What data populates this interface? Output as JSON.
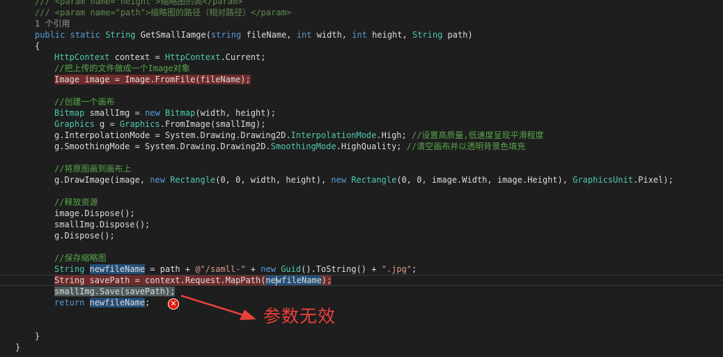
{
  "editor": {
    "lines": [
      {
        "tokens": [
          {
            "t": "/// <param name=\"height\">缩略图的高</param>",
            "c": "xml"
          }
        ]
      },
      {
        "tokens": [
          {
            "t": "/// <param name=\"path\">缩略图的路径（相对路径）</param>",
            "c": "xml"
          }
        ]
      },
      {
        "tokens": [
          {
            "t": "1 个引用",
            "c": "codelens"
          }
        ]
      },
      {
        "tokens": [
          {
            "t": "public",
            "c": "kw"
          },
          {
            "t": " "
          },
          {
            "t": "static",
            "c": "kw"
          },
          {
            "t": " "
          },
          {
            "t": "String",
            "c": "type"
          },
          {
            "t": " GetSmallIamge("
          },
          {
            "t": "string",
            "c": "kw"
          },
          {
            "t": " fileName, "
          },
          {
            "t": "int",
            "c": "kw"
          },
          {
            "t": " width, "
          },
          {
            "t": "int",
            "c": "kw"
          },
          {
            "t": " height, "
          },
          {
            "t": "String",
            "c": "type"
          },
          {
            "t": " path)"
          }
        ]
      },
      {
        "tokens": [
          {
            "t": "{"
          }
        ]
      },
      {
        "tokens": [
          {
            "t": "HttpContext",
            "c": "type"
          },
          {
            "t": " context = "
          },
          {
            "t": "HttpContext",
            "c": "type"
          },
          {
            "t": ".Current;"
          }
        ]
      },
      {
        "tokens": [
          {
            "t": "//把上传的文件做成一个Image对象",
            "c": "comment"
          }
        ]
      },
      {
        "tokens": [
          {
            "t": "Image image = Image.FromFile(fileName);",
            "hl": "bp"
          }
        ]
      },
      {
        "tokens": []
      },
      {
        "tokens": [
          {
            "t": "//创建一个画布",
            "c": "comment"
          }
        ]
      },
      {
        "tokens": [
          {
            "t": "Bitmap",
            "c": "type"
          },
          {
            "t": " smallImg = "
          },
          {
            "t": "new",
            "c": "kw"
          },
          {
            "t": " "
          },
          {
            "t": "Bitmap",
            "c": "type"
          },
          {
            "t": "(width, height);"
          }
        ]
      },
      {
        "tokens": [
          {
            "t": "Graphics",
            "c": "type"
          },
          {
            "t": " g = "
          },
          {
            "t": "Graphics",
            "c": "type"
          },
          {
            "t": ".FromImage(smallImg);"
          }
        ]
      },
      {
        "tokens": [
          {
            "t": "g.InterpolationMode = System.Drawing.Drawing2D."
          },
          {
            "t": "InterpolationMode",
            "c": "type"
          },
          {
            "t": ".High; "
          },
          {
            "t": "//设置高质量,低速度呈现平滑程度",
            "c": "comment"
          }
        ]
      },
      {
        "tokens": [
          {
            "t": "g.SmoothingMode = System.Drawing.Drawing2D."
          },
          {
            "t": "SmoothingMode",
            "c": "type"
          },
          {
            "t": ".HighQuality; "
          },
          {
            "t": "//清空画布并以透明背景色填充",
            "c": "comment"
          }
        ]
      },
      {
        "tokens": []
      },
      {
        "tokens": [
          {
            "t": "//将原图画到画布上",
            "c": "comment"
          }
        ]
      },
      {
        "tokens": [
          {
            "t": "g.DrawImage(image, "
          },
          {
            "t": "new",
            "c": "kw"
          },
          {
            "t": " "
          },
          {
            "t": "Rectangle",
            "c": "type"
          },
          {
            "t": "(0, 0, width, height), "
          },
          {
            "t": "new",
            "c": "kw"
          },
          {
            "t": " "
          },
          {
            "t": "Rectangle",
            "c": "type"
          },
          {
            "t": "(0, 0, image.Width, image.Height), "
          },
          {
            "t": "GraphicsUnit",
            "c": "type"
          },
          {
            "t": ".Pixel);"
          }
        ]
      },
      {
        "tokens": []
      },
      {
        "tokens": [
          {
            "t": "//释放资源",
            "c": "comment"
          }
        ]
      },
      {
        "tokens": [
          {
            "t": "image.Dispose();"
          }
        ]
      },
      {
        "tokens": [
          {
            "t": "smallImg.Dispose();"
          }
        ]
      },
      {
        "tokens": [
          {
            "t": "g.Dispose();"
          }
        ]
      },
      {
        "tokens": []
      },
      {
        "tokens": [
          {
            "t": "//保存缩略图",
            "c": "comment"
          }
        ]
      },
      {
        "tokens": [
          {
            "t": "String",
            "c": "type"
          },
          {
            "t": " "
          },
          {
            "t": "newfileName",
            "hl": "sel"
          },
          {
            "t": " = path + "
          },
          {
            "t": "@\"/samll-\"",
            "c": "string"
          },
          {
            "t": " + "
          },
          {
            "t": "new",
            "c": "kw"
          },
          {
            "t": " "
          },
          {
            "t": "Guid",
            "c": "type"
          },
          {
            "t": "().ToString() + "
          },
          {
            "t": "\".jpg\"",
            "c": "string"
          },
          {
            "t": ";"
          }
        ]
      },
      {
        "tokens": [
          {
            "t": "String savePath = context.Request.MapPath(",
            "hl": "bp"
          },
          {
            "t": "ne",
            "hl": "selbp"
          },
          {
            "t": "|",
            "cursor": true
          },
          {
            "t": "wfileName",
            "hl": "selbp"
          },
          {
            "t": ");",
            "hl": "bp"
          }
        ]
      },
      {
        "tokens": [
          {
            "t": "smallImg.Save(savePath);",
            "hl": "grey"
          }
        ]
      },
      {
        "tokens": [
          {
            "t": "return",
            "c": "kw"
          },
          {
            "t": " "
          },
          {
            "t": "newfileName",
            "hl": "sel"
          },
          {
            "t": ";"
          }
        ]
      },
      {
        "tokens": []
      },
      {
        "tokens": []
      },
      {
        "tokens": [
          {
            "t": "}"
          }
        ]
      },
      {
        "tokens": [
          {
            "t": "}"
          }
        ]
      }
    ]
  },
  "error_icon": {
    "glyph": "✕",
    "color": "#e51400"
  },
  "annotation": {
    "text": "参数无效",
    "color": "#e8413c"
  }
}
